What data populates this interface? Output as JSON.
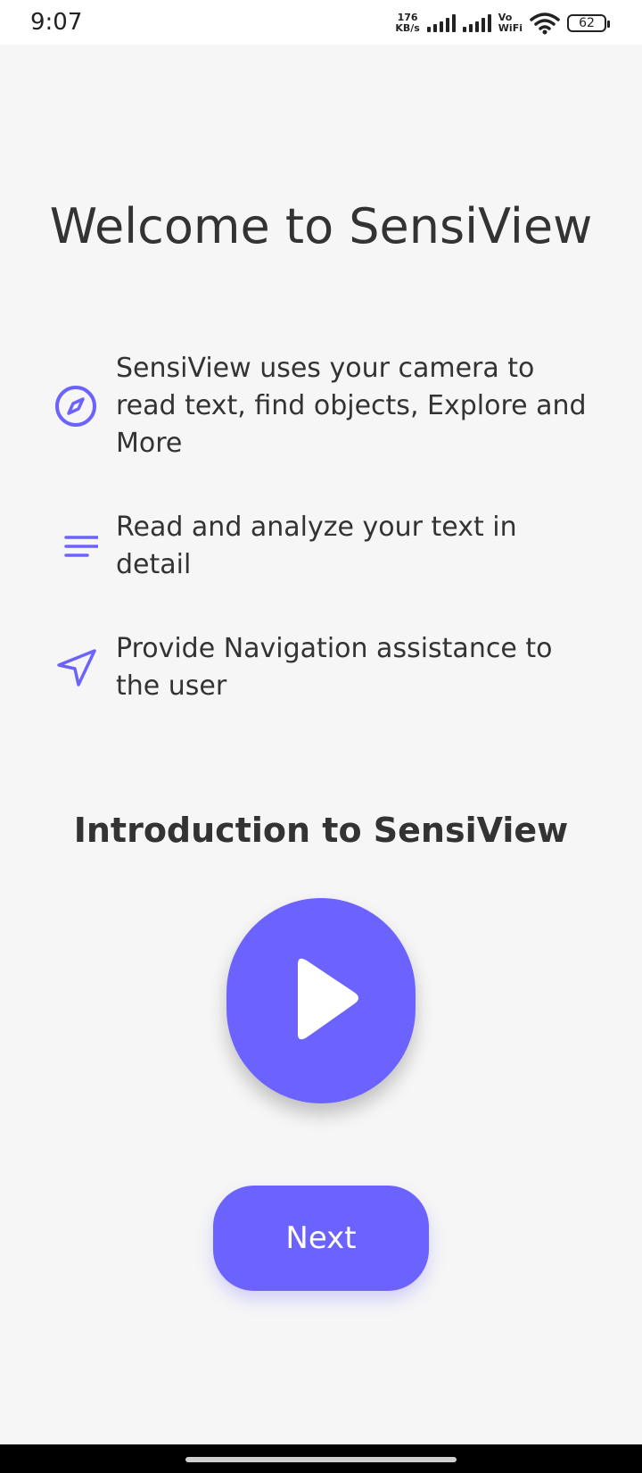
{
  "status_bar": {
    "time": "9:07",
    "net_speed_value": "176",
    "net_speed_unit": "KB/s",
    "vo": "Vo",
    "wifi_label": "WiFi",
    "battery": "62"
  },
  "main": {
    "title": "Welcome to SensiView",
    "features": [
      {
        "icon": "compass-icon",
        "text": "SensiView uses your camera to read text, find objects, Explore and More"
      },
      {
        "icon": "text-lines-icon",
        "text": "Read and analyze your text in detail"
      },
      {
        "icon": "navigation-arrow-icon",
        "text": "Provide Navigation assistance to the user"
      }
    ],
    "intro_heading": "Introduction to SensiView",
    "next_label": "Next"
  },
  "colors": {
    "accent": "#6c63ff",
    "background": "#f6f6f6",
    "text": "#333333"
  }
}
